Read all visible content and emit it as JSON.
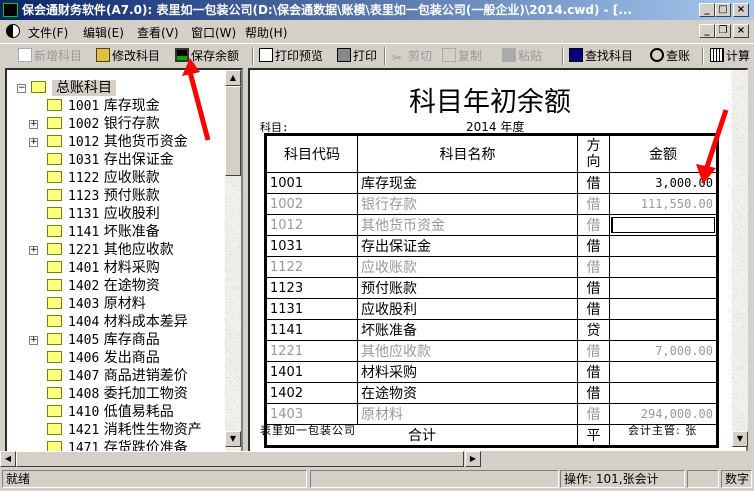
{
  "window": {
    "title": "保会通财务软件(A7.0): 表里如一包装公司(D:\\保会通数据\\账模\\表里如一包装公司(一般企业)\\2014.cwd) - [..."
  },
  "menu": [
    "文件(F)",
    "编辑(E)",
    "查看(V)",
    "窗口(W)",
    "帮助(H)"
  ],
  "toolbar": [
    {
      "label": "新增科目",
      "icon": "new-doc-icon",
      "enabled": false
    },
    {
      "label": "修改科目",
      "icon": "open-folder-icon",
      "enabled": true
    },
    {
      "label": "保存余额",
      "icon": "save-disk-icon",
      "enabled": true
    },
    {
      "label": "打印预览",
      "icon": "print-preview-icon",
      "enabled": true
    },
    {
      "label": "打印",
      "icon": "printer-icon",
      "enabled": true
    },
    {
      "label": "剪切",
      "icon": "scissors-icon",
      "enabled": false
    },
    {
      "label": "复制",
      "icon": "copy-icon",
      "enabled": false
    },
    {
      "label": "粘贴",
      "icon": "paste-icon",
      "enabled": false
    },
    {
      "label": "查找科目",
      "icon": "find-icon",
      "enabled": true
    },
    {
      "label": "查账",
      "icon": "magnifier-icon",
      "enabled": true
    },
    {
      "label": "计算",
      "icon": "calculator-icon",
      "enabled": true
    }
  ],
  "tree": {
    "root": "总账科目",
    "items": [
      {
        "code": "1001",
        "name": "库存现金",
        "expandable": false
      },
      {
        "code": "1002",
        "name": "银行存款",
        "expandable": true
      },
      {
        "code": "1012",
        "name": "其他货币资金",
        "expandable": true
      },
      {
        "code": "1031",
        "name": "存出保证金",
        "expandable": false
      },
      {
        "code": "1122",
        "name": "应收账款",
        "expandable": false
      },
      {
        "code": "1123",
        "name": "预付账款",
        "expandable": false
      },
      {
        "code": "1131",
        "name": "应收股利",
        "expandable": false
      },
      {
        "code": "1141",
        "name": "坏账准备",
        "expandable": false
      },
      {
        "code": "1221",
        "name": "其他应收款",
        "expandable": true
      },
      {
        "code": "1401",
        "name": "材料采购",
        "expandable": false
      },
      {
        "code": "1402",
        "name": "在途物资",
        "expandable": false
      },
      {
        "code": "1403",
        "name": "原材料",
        "expandable": false
      },
      {
        "code": "1404",
        "name": "材料成本差异",
        "expandable": false
      },
      {
        "code": "1405",
        "name": "库存商品",
        "expandable": true
      },
      {
        "code": "1406",
        "name": "发出商品",
        "expandable": false
      },
      {
        "code": "1407",
        "name": "商品进销差价",
        "expandable": false
      },
      {
        "code": "1408",
        "name": "委托加工物资",
        "expandable": false
      },
      {
        "code": "1410",
        "name": "低值易耗品",
        "expandable": false
      },
      {
        "code": "1421",
        "name": "消耗性生物资产",
        "expandable": false
      },
      {
        "code": "1471",
        "name": "存货跌价准备",
        "expandable": false
      }
    ]
  },
  "report": {
    "title": "科目年初余额",
    "subject_label": "科目:",
    "year_label": "2014 年度",
    "headers": [
      "科目代码",
      "科目名称",
      "方向",
      "金额"
    ],
    "rows": [
      {
        "code": "1001",
        "name": "库存现金",
        "dir": "借",
        "amount": "3,000.00",
        "gray": false
      },
      {
        "code": "1002",
        "name": "银行存款",
        "dir": "借",
        "amount": "111,550.00",
        "gray": true
      },
      {
        "code": "1012",
        "name": "其他货币资金",
        "dir": "借",
        "amount": "",
        "gray": true,
        "editing": true
      },
      {
        "code": "1031",
        "name": "存出保证金",
        "dir": "借",
        "amount": "",
        "gray": false
      },
      {
        "code": "1122",
        "name": "应收账款",
        "dir": "借",
        "amount": "",
        "gray": true
      },
      {
        "code": "1123",
        "name": "预付账款",
        "dir": "借",
        "amount": "",
        "gray": false
      },
      {
        "code": "1131",
        "name": "应收股利",
        "dir": "借",
        "amount": "",
        "gray": false
      },
      {
        "code": "1141",
        "name": "坏账准备",
        "dir": "贷",
        "amount": "",
        "gray": false
      },
      {
        "code": "1221",
        "name": "其他应收款",
        "dir": "借",
        "amount": "7,000.00",
        "gray": true
      },
      {
        "code": "1401",
        "name": "材料采购",
        "dir": "借",
        "amount": "",
        "gray": false
      },
      {
        "code": "1402",
        "name": "在途物资",
        "dir": "借",
        "amount": "",
        "gray": false
      },
      {
        "code": "1403",
        "name": "原材料",
        "dir": "借",
        "amount": "294,000.00",
        "gray": true
      }
    ],
    "total_label": "合计",
    "total_dir": "平",
    "total_amount": "",
    "company": "表里如一包装公司",
    "supervisor": "会计主管: 张"
  },
  "status": {
    "ready": "就绪",
    "operator": "操作: 101,张会计",
    "mode": "数字"
  },
  "colors": {
    "title_start": "#0a246a",
    "title_end": "#a6caf0",
    "annotation_arrow": "#ff0000",
    "gray_text": "#999999"
  }
}
